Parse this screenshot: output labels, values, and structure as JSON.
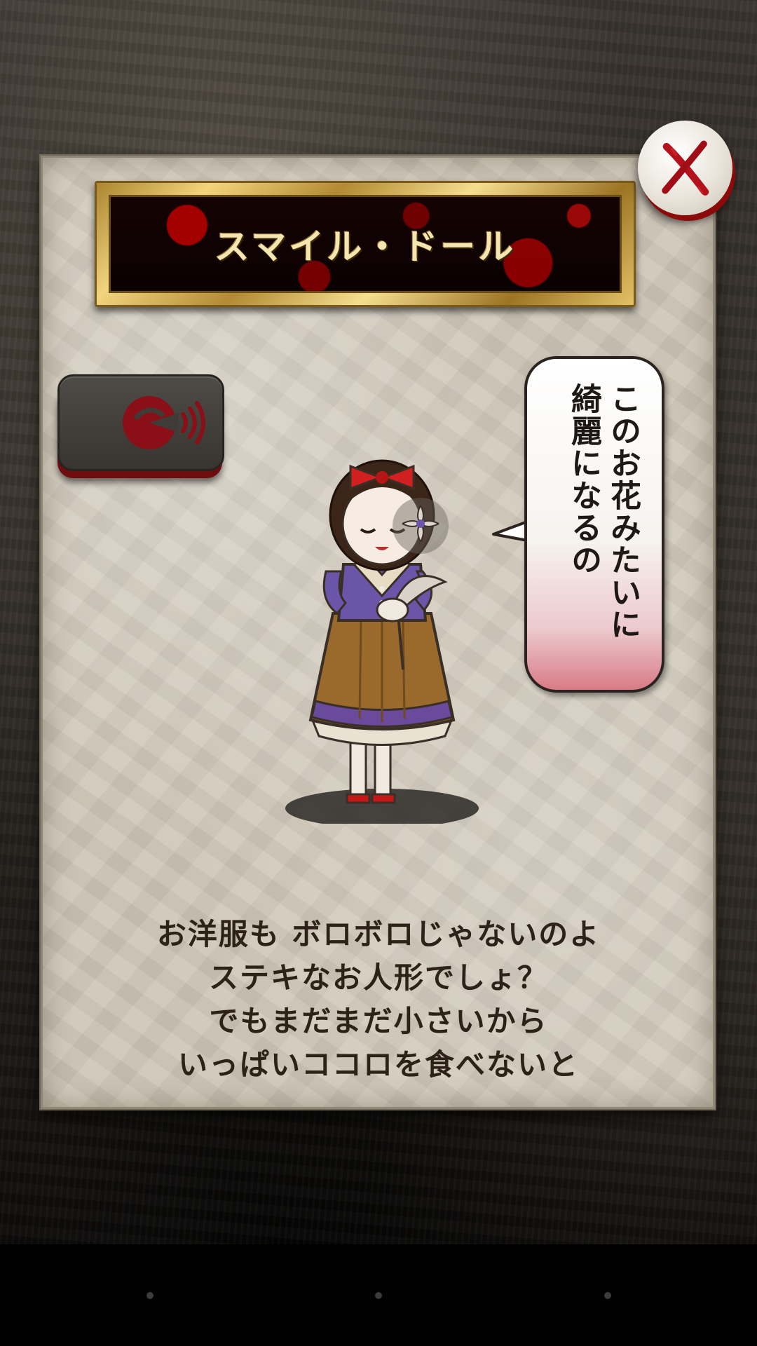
{
  "character": {
    "name": "スマイル・ドール"
  },
  "speech": {
    "lines": [
      "このお花みたいに",
      "綺麗になるの"
    ]
  },
  "story": {
    "lines": [
      "お洋服も ボロボロじゃないのよ",
      "ステキなお人形でしょ？",
      "でもまだまだ小さいから",
      "いっぱいココロを食べないと"
    ]
  },
  "buttons": {
    "close_icon": "x-mark-icon",
    "voice_icon": "speaking-head-icon"
  },
  "colors": {
    "accent_red": "#a3141c",
    "gold_frame": "#d9b660",
    "paper": "#cfc7b8"
  },
  "navigation": {
    "dots": [
      "nav-dot-left",
      "nav-dot-center",
      "nav-dot-right"
    ]
  }
}
